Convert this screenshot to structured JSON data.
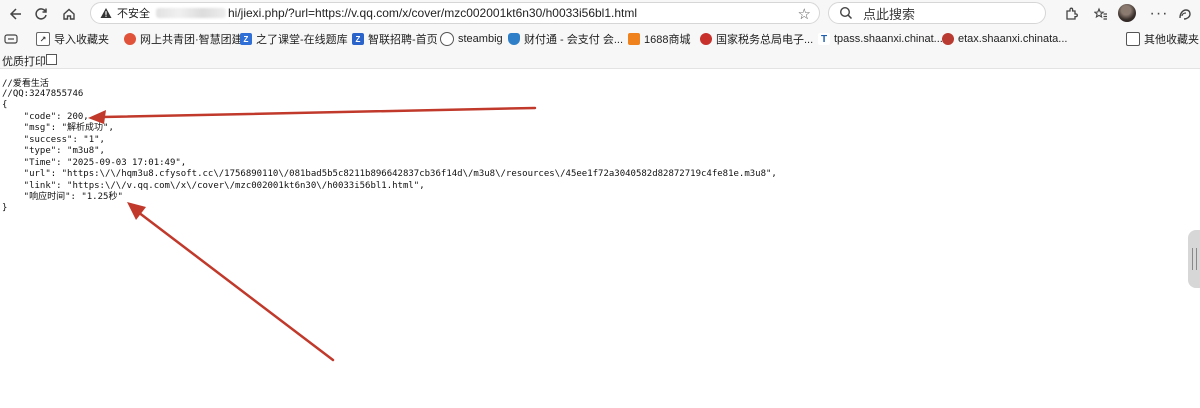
{
  "browser": {
    "security_label": "不安全",
    "url_visible": "hi/jiexi.php/?url=https://v.qq.com/x/cover/mzc002001kt6n30/h0033i56bl1.html",
    "search_placeholder": "点此搜索"
  },
  "bookmarks": {
    "import": "导入收藏夹",
    "items": [
      "网上共青团·智慧团建",
      "之了课堂-在线题库",
      "智联招聘-首页",
      "steambig",
      "财付通 - 会支付 会...",
      "1688商城",
      "国家税务总局电子...",
      "tpass.shaanxi.chinat...",
      "etax.shaanxi.chinata..."
    ],
    "other": "其他收藏夹"
  },
  "print_bar": {
    "label": "优质打印"
  },
  "content": {
    "lines": [
      "//爱看生活",
      "//QQ:3247855746",
      "{",
      "    \"code\": 200,",
      "    \"msg\": \"解析成功\",",
      "    \"success\": \"1\",",
      "    \"type\": \"m3u8\",",
      "    \"Time\": \"2025-09-03 17:01:49\",",
      "    \"url\": \"https:\\/\\/hqm3u8.cfysoft.cc\\/1756890110\\/081bad5b5c8211b896642837cb36f14d\\/m3u8\\/resources\\/45ee1f72a3040582d82872719c4fe81e.m3u8\",",
      "    \"link\": \"https:\\/\\/v.qq.com\\/x\\/cover\\/mzc002001kt6n30\\/h0033i56bl1.html\",",
      "    \"响应时间\": \"1.25秒\"",
      "}"
    ]
  },
  "colors": {
    "arrow": "#c0392b"
  }
}
